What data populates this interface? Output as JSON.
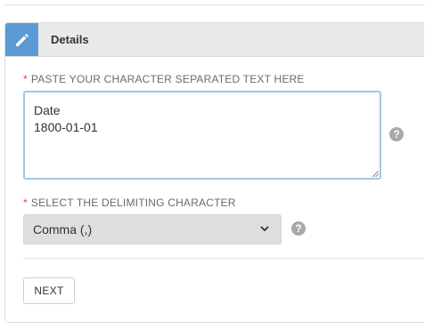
{
  "panel": {
    "title": "Details",
    "header_icon": "pencil-icon",
    "accent_color": "#5b9bd5"
  },
  "text_field": {
    "required_marker": "*",
    "label": "PASTE YOUR CHARACTER SEPARATED TEXT HERE",
    "value": "Date\n1800-01-01",
    "help_icon": "question-icon"
  },
  "delimiter_field": {
    "required_marker": "*",
    "label": "SELECT THE DELIMITING CHARACTER",
    "selected": "Comma (,)",
    "help_icon": "question-icon"
  },
  "help_symbol": "?",
  "actions": {
    "next_label": "NEXT"
  }
}
